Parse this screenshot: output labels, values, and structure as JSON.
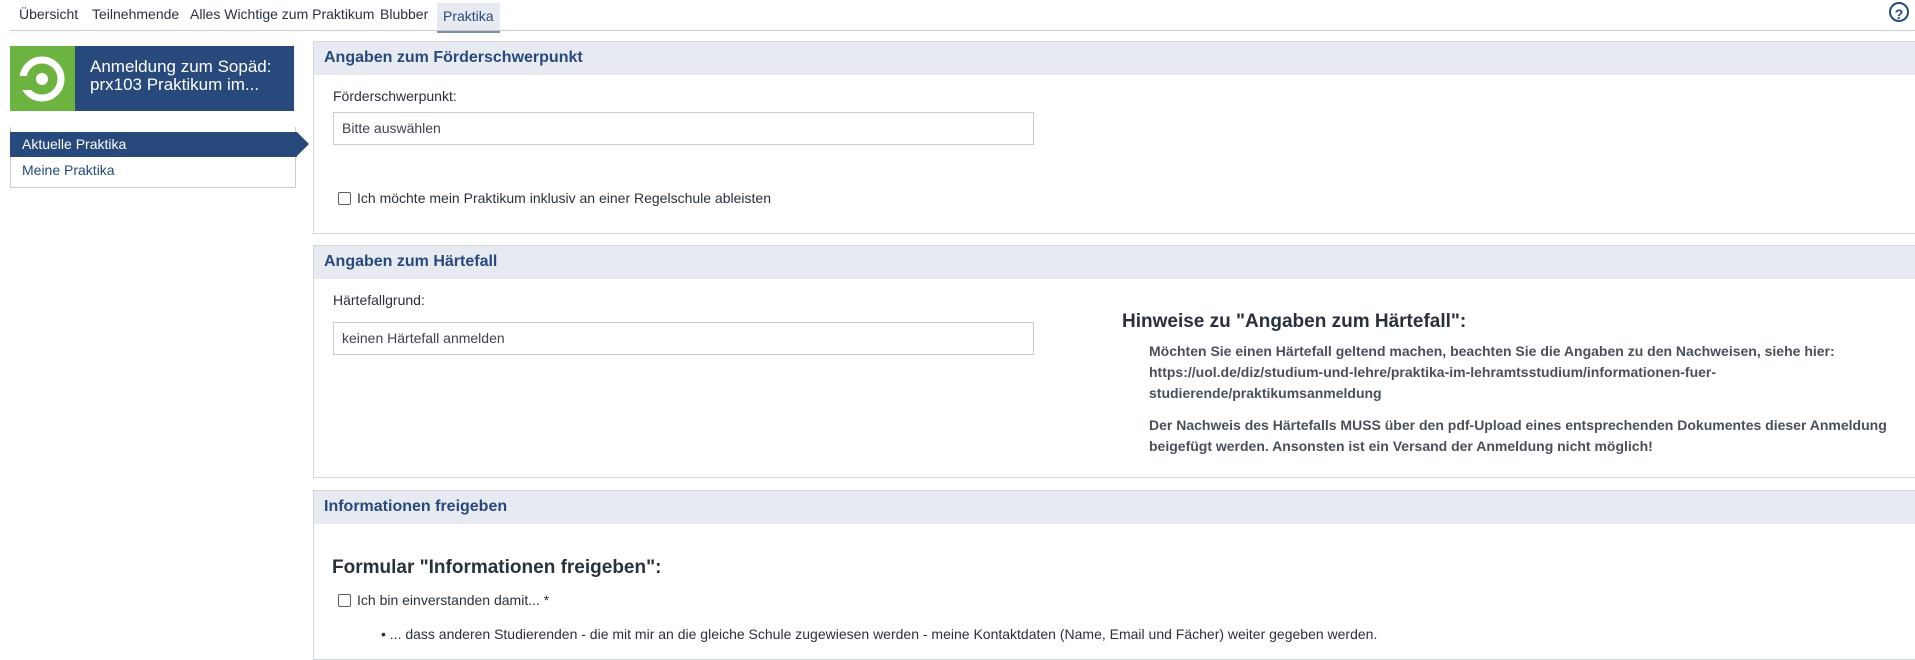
{
  "tabs": [
    {
      "label": "Übersicht"
    },
    {
      "label": "Teilnehmende"
    },
    {
      "label": "Alles Wichtige zum Praktikum"
    },
    {
      "label": "Blubber"
    },
    {
      "label": "Praktika"
    }
  ],
  "help_label": "?",
  "course": {
    "title": "Anmeldung zum Sopäd: prx103 Praktikum im..."
  },
  "sidebar": {
    "items": [
      {
        "label": "Aktuelle Praktika"
      },
      {
        "label": "Meine Praktika"
      }
    ]
  },
  "sections": {
    "foerder": {
      "title": "Angaben zum Förderschwerpunkt",
      "field_label": "Förderschwerpunkt:",
      "select_value": "Bitte auswählen",
      "checkbox_label": "Ich möchte mein Praktikum inklusiv an einer Regelschule ableisten"
    },
    "haerte": {
      "title": "Angaben zum Härtefall",
      "field_label": "Härtefallgrund:",
      "select_value": "keinen Härtefall anmelden",
      "hint_title": "Hinweise zu \"Angaben zum Härtefall\":",
      "hint_p1_line1": "Möchten Sie einen Härtefall geltend machen, beachten Sie die Angaben zu den Nachweisen, siehe hier:",
      "hint_p1_line2": "https://uol.de/diz/studium-und-lehre/praktika-im-lehramtsstudium/informationen-fuer-",
      "hint_p1_line3": "studierende/praktikumsanmeldung",
      "hint_p2_line1": "Der Nachweis des Härtefalls MUSS über den pdf-Upload eines entsprechenden Dokumentes dieser Anmeldung",
      "hint_p2_line2": "beigefügt werden. Ansonsten ist ein Versand der Anmeldung nicht möglich!"
    },
    "info": {
      "title": "Informationen freigeben",
      "form_title": "Formular \"Informationen freigeben\":",
      "checkbox_label": "Ich bin einverstanden damit... *",
      "bullet": "• ... dass anderen Studierenden - die mit mir an die gleiche Schule zugewiesen werden - meine Kontaktdaten (Name, Email und Fächer) weiter gegeben werden."
    }
  },
  "colors": {
    "primary": "#28497c",
    "logo_green": "#6cb33f",
    "section_head_bg": "#e7ebf1"
  }
}
